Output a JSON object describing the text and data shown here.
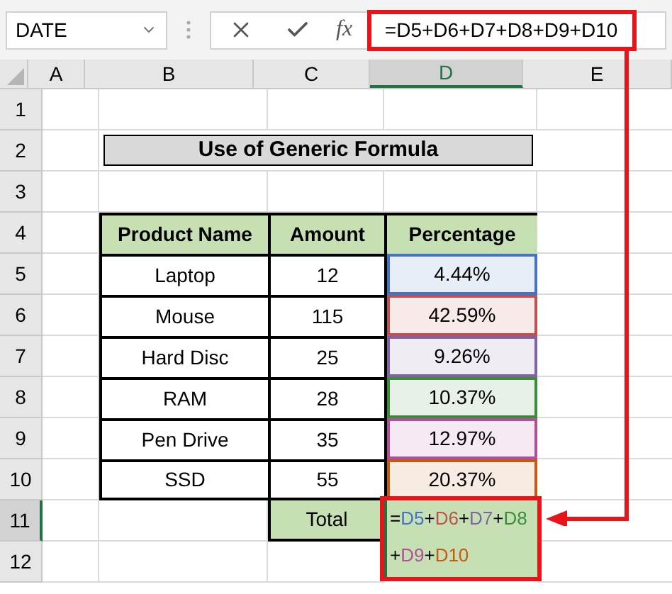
{
  "name_box": {
    "value": "DATE"
  },
  "formula_bar": {
    "function_label": "fx",
    "formula": "=D5+D6+D7+D8+D9+D10"
  },
  "columns": [
    {
      "label": "A",
      "selected": false
    },
    {
      "label": "B",
      "selected": false
    },
    {
      "label": "C",
      "selected": false
    },
    {
      "label": "D",
      "selected": true
    },
    {
      "label": "E",
      "selected": false
    }
  ],
  "row_headers": [
    {
      "label": "1",
      "selected": false
    },
    {
      "label": "2",
      "selected": false
    },
    {
      "label": "3",
      "selected": false
    },
    {
      "label": "4",
      "selected": false
    },
    {
      "label": "5",
      "selected": false
    },
    {
      "label": "6",
      "selected": false
    },
    {
      "label": "7",
      "selected": false
    },
    {
      "label": "8",
      "selected": false
    },
    {
      "label": "9",
      "selected": false
    },
    {
      "label": "10",
      "selected": false
    },
    {
      "label": "11",
      "selected": true
    },
    {
      "label": "12",
      "selected": false
    }
  ],
  "title": "Use of Generic Formula",
  "table": {
    "columns": [
      "Product Name",
      "Amount",
      "Percentage"
    ],
    "rows": [
      {
        "product": "Laptop",
        "amount": "12",
        "percentage": "4.44%",
        "color": "#4472c4"
      },
      {
        "product": "Mouse",
        "amount": "115",
        "percentage": "42.59%",
        "color": "#c0504d"
      },
      {
        "product": "Hard Disc",
        "amount": "25",
        "percentage": "9.26%",
        "color": "#8064a2"
      },
      {
        "product": "RAM",
        "amount": "28",
        "percentage": "10.37%",
        "color": "#3a8e3a"
      },
      {
        "product": "Pen Drive",
        "amount": "35",
        "percentage": "12.97%",
        "color": "#b04f9a"
      },
      {
        "product": "SSD",
        "amount": "55",
        "percentage": "20.37%",
        "color": "#c65911"
      }
    ]
  },
  "total": {
    "label": "Total",
    "formula_lines": [
      [
        {
          "text": "=",
          "color": "#000000"
        },
        {
          "text": "D5",
          "color": "#4472c4"
        },
        {
          "text": "+",
          "color": "#000000"
        },
        {
          "text": "D6",
          "color": "#c0504d"
        },
        {
          "text": "+",
          "color": "#000000"
        },
        {
          "text": "D7",
          "color": "#8064a2"
        },
        {
          "text": "+",
          "color": "#000000"
        },
        {
          "text": "D8",
          "color": "#3a8e3a"
        }
      ],
      [
        {
          "text": "+",
          "color": "#000000"
        },
        {
          "text": "D9",
          "color": "#b04f9a"
        },
        {
          "text": "+",
          "color": "#000000"
        },
        {
          "text": "D10",
          "color": "#c65911"
        }
      ]
    ]
  }
}
